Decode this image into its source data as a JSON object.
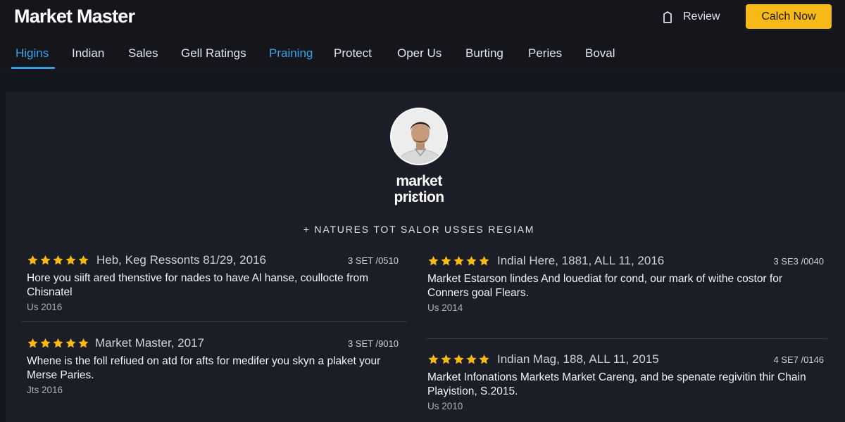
{
  "header": {
    "logo": "Market Master",
    "review_label": "Review",
    "cta_label": "Calch Now"
  },
  "nav": {
    "tabs": [
      {
        "label": "Higins"
      },
      {
        "label": "Indian"
      },
      {
        "label": "Sales"
      },
      {
        "label": "Gell Ratings"
      },
      {
        "label": "Praining"
      },
      {
        "label": "Protect"
      },
      {
        "label": "Oper Us"
      },
      {
        "label": "Burting"
      },
      {
        "label": "Peries"
      },
      {
        "label": "Boval"
      }
    ]
  },
  "profile": {
    "name_line1": "market",
    "name_line2": "priɛtion",
    "tagline": "+ NATURES TOT SALOR USSES REGIAM"
  },
  "reviews": [
    {
      "stars": 5,
      "reviewer": "Heb, Keg Ressonts 81/29, 2016",
      "code": "3 SET /0510",
      "text": "Hore you siift ared thenstive for nades to have Al hanse, coullocte from Chisnatel",
      "date": "Us 2016"
    },
    {
      "stars": 5,
      "reviewer": "Indial Here, 1881, ALL 11, 2016",
      "code": "3 SE3 /0040",
      "text": "Market Estarson lindes And louediat for cond, our mark of withe costor for Conners goal Flears.",
      "date": "Us 2014"
    },
    {
      "stars": 5,
      "reviewer": "Market Master, 2017",
      "code": "3 SET /9010",
      "text": "Whene is the foll refiued on atd for afts for medifer you skyn a plaket your Merse Paries.",
      "date": "Jts 2016"
    },
    {
      "stars": 5,
      "reviewer": "Indian Mag, 188, ALL 11, 2015",
      "code": "4 SE7 /0146",
      "text": "Market Infonations Markets Market Careng, and be spenate regivitin thir Chain Playistion, S.2015.",
      "date": "Us 2010"
    }
  ],
  "colors": {
    "accent": "#f7b917",
    "nav_active": "#3ba2ea",
    "star": "#f7b917",
    "panel_bg": "#1b1e26"
  },
  "icons": {
    "review": "bookmark-icon",
    "star": "star-icon",
    "avatar": "user-photo"
  }
}
